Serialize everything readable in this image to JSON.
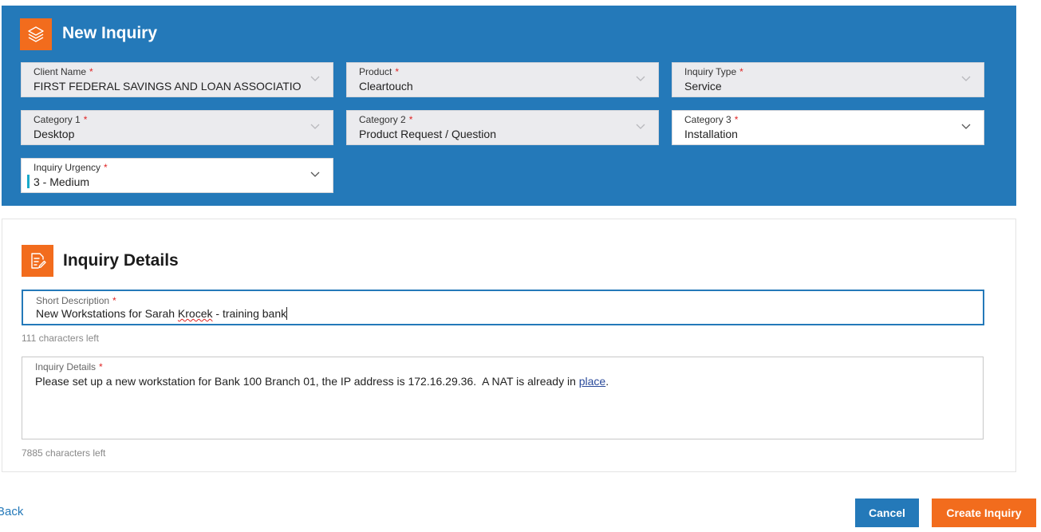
{
  "header": {
    "title": "New Inquiry",
    "icon": "layers-icon"
  },
  "fields": {
    "client_name": {
      "label": "Client Name",
      "value": "FIRST FEDERAL SAVINGS AND LOAN ASSOCIATIO..."
    },
    "product": {
      "label": "Product",
      "value": "Cleartouch"
    },
    "inquiry_type": {
      "label": "Inquiry Type",
      "value": "Service"
    },
    "category1": {
      "label": "Category 1",
      "value": "Desktop"
    },
    "category2": {
      "label": "Category 2",
      "value": "Product Request / Question"
    },
    "category3": {
      "label": "Category 3",
      "value": "Installation"
    },
    "urgency": {
      "label": "Inquiry Urgency",
      "value": "3 - Medium"
    }
  },
  "required_mark": "*",
  "details": {
    "title": "Inquiry Details",
    "icon": "edit-document-icon",
    "short_description": {
      "label": "Short Description",
      "value_part1": "New Workstations for Sarah ",
      "value_misspelled": "Krocek",
      "value_part2": " - training bank",
      "counter": "111 characters left"
    },
    "inquiry_details": {
      "label": "Inquiry Details",
      "value_part1": "Please set up a new workstation for Bank 100 Branch 01, the IP address is 172.16.29.36.  A NAT is already in ",
      "value_link": "place",
      "value_part2": ".",
      "counter": "7885 characters left"
    }
  },
  "footer": {
    "back_label": "Back",
    "cancel_label": "Cancel",
    "create_label": "Create Inquiry"
  },
  "colors": {
    "header_blue": "#2479b9",
    "accent_orange": "#f26c1d",
    "urgency_teal": "#19a9c9",
    "required_red": "#e02424"
  }
}
